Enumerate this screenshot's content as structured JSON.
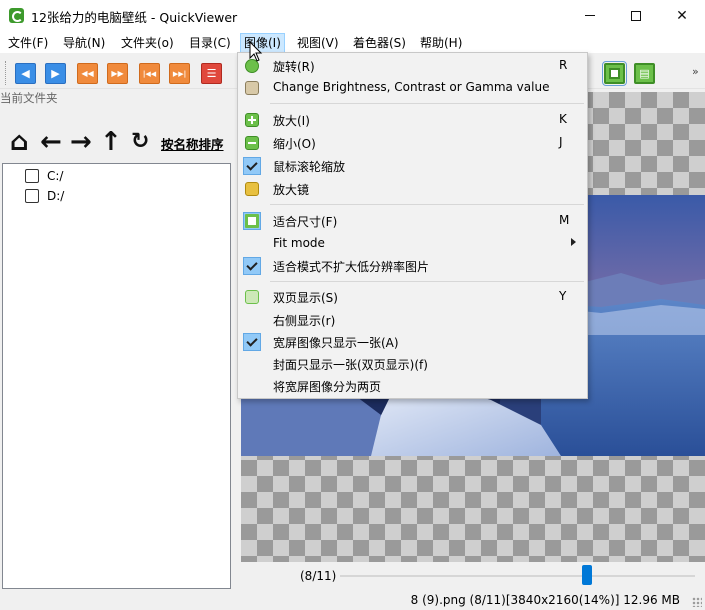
{
  "window": {
    "title": "12张给力的电脑壁纸 - QuickViewer",
    "minimize": "—",
    "maximize": "☐",
    "close": "✕"
  },
  "menubar": {
    "items": [
      {
        "label": "文件(F)"
      },
      {
        "label": "导航(N)"
      },
      {
        "label": "文件夹(o)"
      },
      {
        "label": "目录(C)"
      },
      {
        "label": "图像(I)"
      },
      {
        "label": "视图(V)"
      },
      {
        "label": "着色器(S)"
      },
      {
        "label": "帮助(H)"
      }
    ]
  },
  "toolbar": {
    "buttons": [
      {
        "icon": "prev-icon",
        "glyph": "◀"
      },
      {
        "icon": "next-icon",
        "glyph": "▶"
      },
      {
        "icon": "fast-back-icon",
        "glyph": "◀◀"
      },
      {
        "icon": "fast-forward-icon",
        "glyph": "▶▶"
      },
      {
        "icon": "first-icon",
        "glyph": "|◀◀"
      },
      {
        "icon": "last-icon",
        "glyph": "▶▶|"
      },
      {
        "icon": "list-icon",
        "glyph": "☰"
      },
      {
        "icon": "fit-window-icon",
        "glyph": ""
      },
      {
        "icon": "dual-page-icon",
        "glyph": "▤"
      }
    ],
    "overflow": "»"
  },
  "folder_panel": {
    "header": "当前文件夹",
    "sort_label": "按名称排序",
    "nav_icons": {
      "home": "⌂",
      "back": "←",
      "forward": "→",
      "up": "↑",
      "refresh": "↻"
    },
    "tree": [
      {
        "label": "C:/"
      },
      {
        "label": "D:/"
      }
    ]
  },
  "image_menu": {
    "items": [
      {
        "label": "旋转(R)",
        "shortcut": "R",
        "icon": "rotate-icon"
      },
      {
        "label": "Change Brightness, Contrast or Gamma value",
        "shortcut": "",
        "icon": "gear-icon"
      },
      {
        "label": "放大(I)",
        "shortcut": "K",
        "icon": "zoom-in-icon"
      },
      {
        "label": "缩小(O)",
        "shortcut": "J",
        "icon": "zoom-out-icon"
      },
      {
        "label": "鼠标滚轮缩放",
        "shortcut": "",
        "icon": "check-icon",
        "checked": true
      },
      {
        "label": "放大镜",
        "shortcut": "",
        "icon": "magnifier-icon"
      },
      {
        "label": "适合尺寸(F)",
        "shortcut": "M",
        "icon": "fit-icon",
        "checked": true
      },
      {
        "label": "Fit mode",
        "shortcut": "",
        "icon": "",
        "submenu": true
      },
      {
        "label": "适合模式不扩大低分辨率图片",
        "shortcut": "",
        "icon": "check-icon",
        "checked": true
      },
      {
        "label": "双页显示(S)",
        "shortcut": "Y",
        "icon": "dual-page-icon"
      },
      {
        "label": "右侧显示(r)",
        "shortcut": "",
        "icon": ""
      },
      {
        "label": "宽屏图像只显示一张(A)",
        "shortcut": "",
        "icon": "check-icon",
        "checked": true
      },
      {
        "label": "封面只显示一张(双页显示)(f)",
        "shortcut": "",
        "icon": ""
      },
      {
        "label": "将宽屏图像分为两页",
        "shortcut": "",
        "icon": ""
      }
    ]
  },
  "viewer": {
    "page_indicator": "(8/11)",
    "slider_position": 0.7
  },
  "status": {
    "text": "8 (9).png (8/11)[3840x2160(14%)] 12.96 MB"
  },
  "colors": {
    "accent": "#0078d7",
    "menu_highlight": "#cce8ff",
    "check_bg": "#91c9f7",
    "toolbar_blue": "#3a8ee6",
    "toolbar_orange": "#f08a3c",
    "toolbar_green": "#6cc04a"
  }
}
